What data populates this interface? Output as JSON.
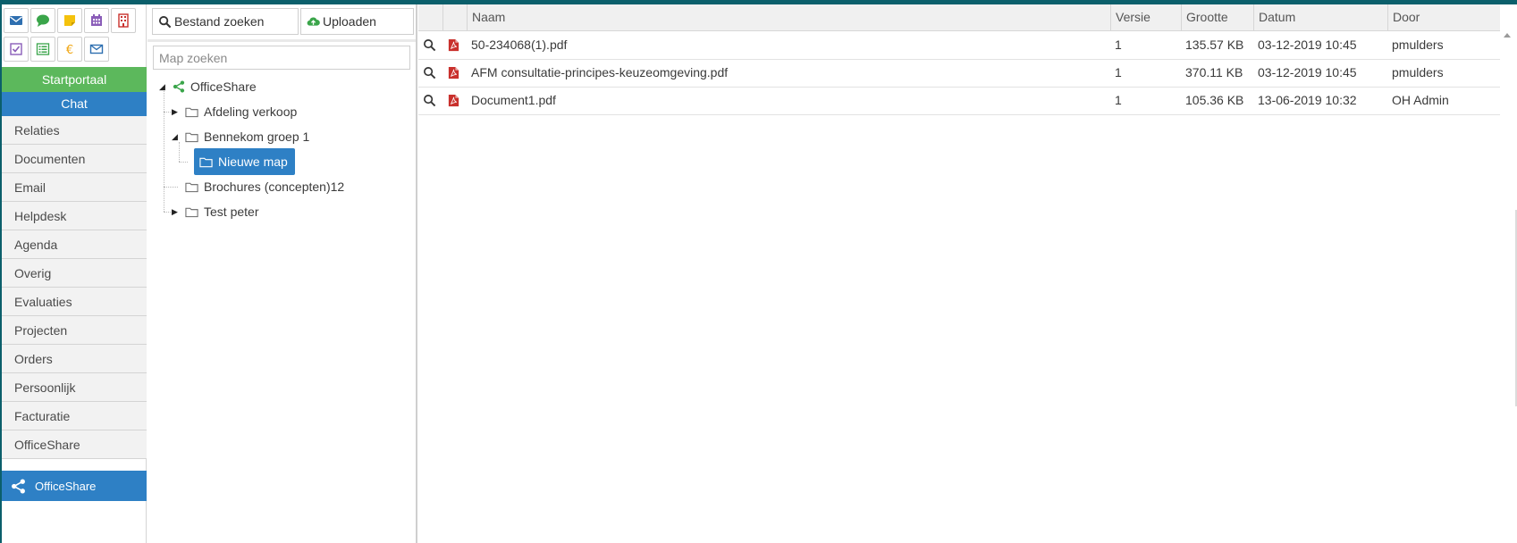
{
  "nav": {
    "startportaal": "Startportaal",
    "chat": "Chat",
    "items": [
      "Relaties",
      "Documenten",
      "Email",
      "Helpdesk",
      "Agenda",
      "Overig",
      "Evaluaties",
      "Projecten",
      "Orders",
      "Persoonlijk",
      "Facturatie",
      "OfficeShare"
    ],
    "active": "OfficeShare",
    "quick_icons": [
      "envelope-icon",
      "chat-bubble-icon",
      "sticky-note-icon",
      "calendar-icon",
      "building-icon",
      "checkbox-icon",
      "list-icon",
      "euro-icon",
      "mail-outline-icon"
    ]
  },
  "middle": {
    "search_button": "Bestand zoeken",
    "upload_button": "Uploaden",
    "map_search_placeholder": "Map zoeken",
    "tree": {
      "root": "OfficeShare",
      "nodes": [
        "Afdeling verkoop",
        "Bennekom groep 1",
        "Nieuwe map",
        "Brochures (concepten)12",
        "Test peter"
      ]
    }
  },
  "grid": {
    "columns": [
      "Naam",
      "Versie",
      "Grootte",
      "Datum",
      "Door"
    ],
    "rows": [
      {
        "name": "50-234068(1).pdf",
        "version": "1",
        "size": "135.57 KB",
        "date": "03-12-2019 10:45",
        "by": "pmulders"
      },
      {
        "name": "AFM consultatie-principes-keuzeomgeving.pdf",
        "version": "1",
        "size": "370.11 KB",
        "date": "03-12-2019 10:45",
        "by": "pmulders"
      },
      {
        "name": "Document1.pdf",
        "version": "1",
        "size": "105.36 KB",
        "date": "13-06-2019 10:32",
        "by": "OH Admin"
      }
    ]
  },
  "colors": {
    "brand_top": "#0b5f6b",
    "green": "#5cb85c",
    "blue": "#2e80c5",
    "pdf_red": "#c9302c"
  }
}
